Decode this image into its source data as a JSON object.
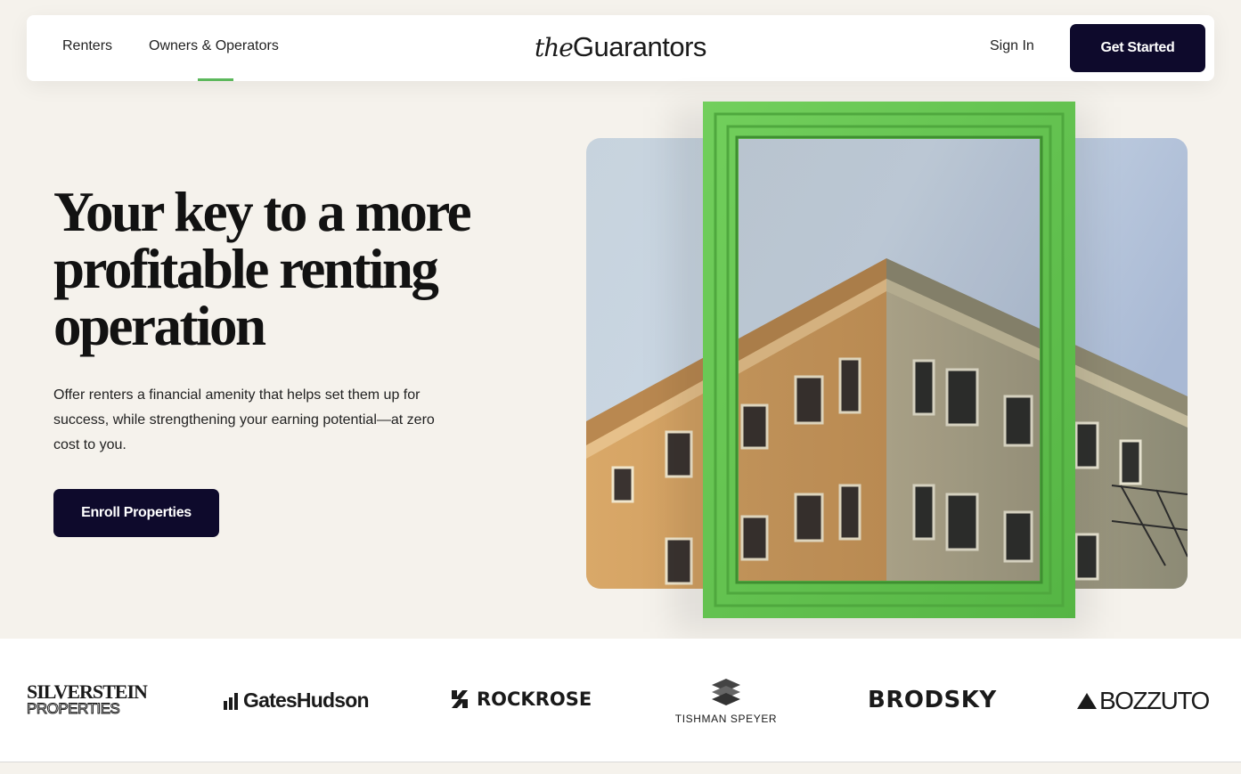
{
  "nav": {
    "links": [
      {
        "label": "Renters"
      },
      {
        "label": "Owners & Operators"
      }
    ],
    "logo_prefix": "the",
    "logo_brand": "Guarantors",
    "sign_in": "Sign In",
    "get_started": "Get Started"
  },
  "hero": {
    "title": "Your key to a more profitable renting operation",
    "subtitle": "Offer renters a financial amenity that helps set them up for success, while strengthening your earning potential—at zero cost to you.",
    "cta": "Enroll Properties"
  },
  "partners": {
    "silverstein_line1": "SILVERSTEIN",
    "silverstein_line2": "PROPERTIES",
    "gates_hudson": "GatesHudson",
    "rockrose": "ROCKROSE",
    "tishman_speyer": "TISHMAN SPEYER",
    "brodsky": "BRODSKY",
    "bozzuto": "BOZZUTO"
  },
  "colors": {
    "page_bg": "#f5f2ec",
    "button_bg": "#0e0a2c",
    "accent_green": "#5cb85c",
    "frame_green": "#62c24e"
  },
  "icons": [
    "building-photo",
    "green-frame",
    "gates-hudson-bars-icon",
    "rockrose-mark-icon",
    "tishman-cube-icon",
    "bozzuto-triangle-icon"
  ]
}
